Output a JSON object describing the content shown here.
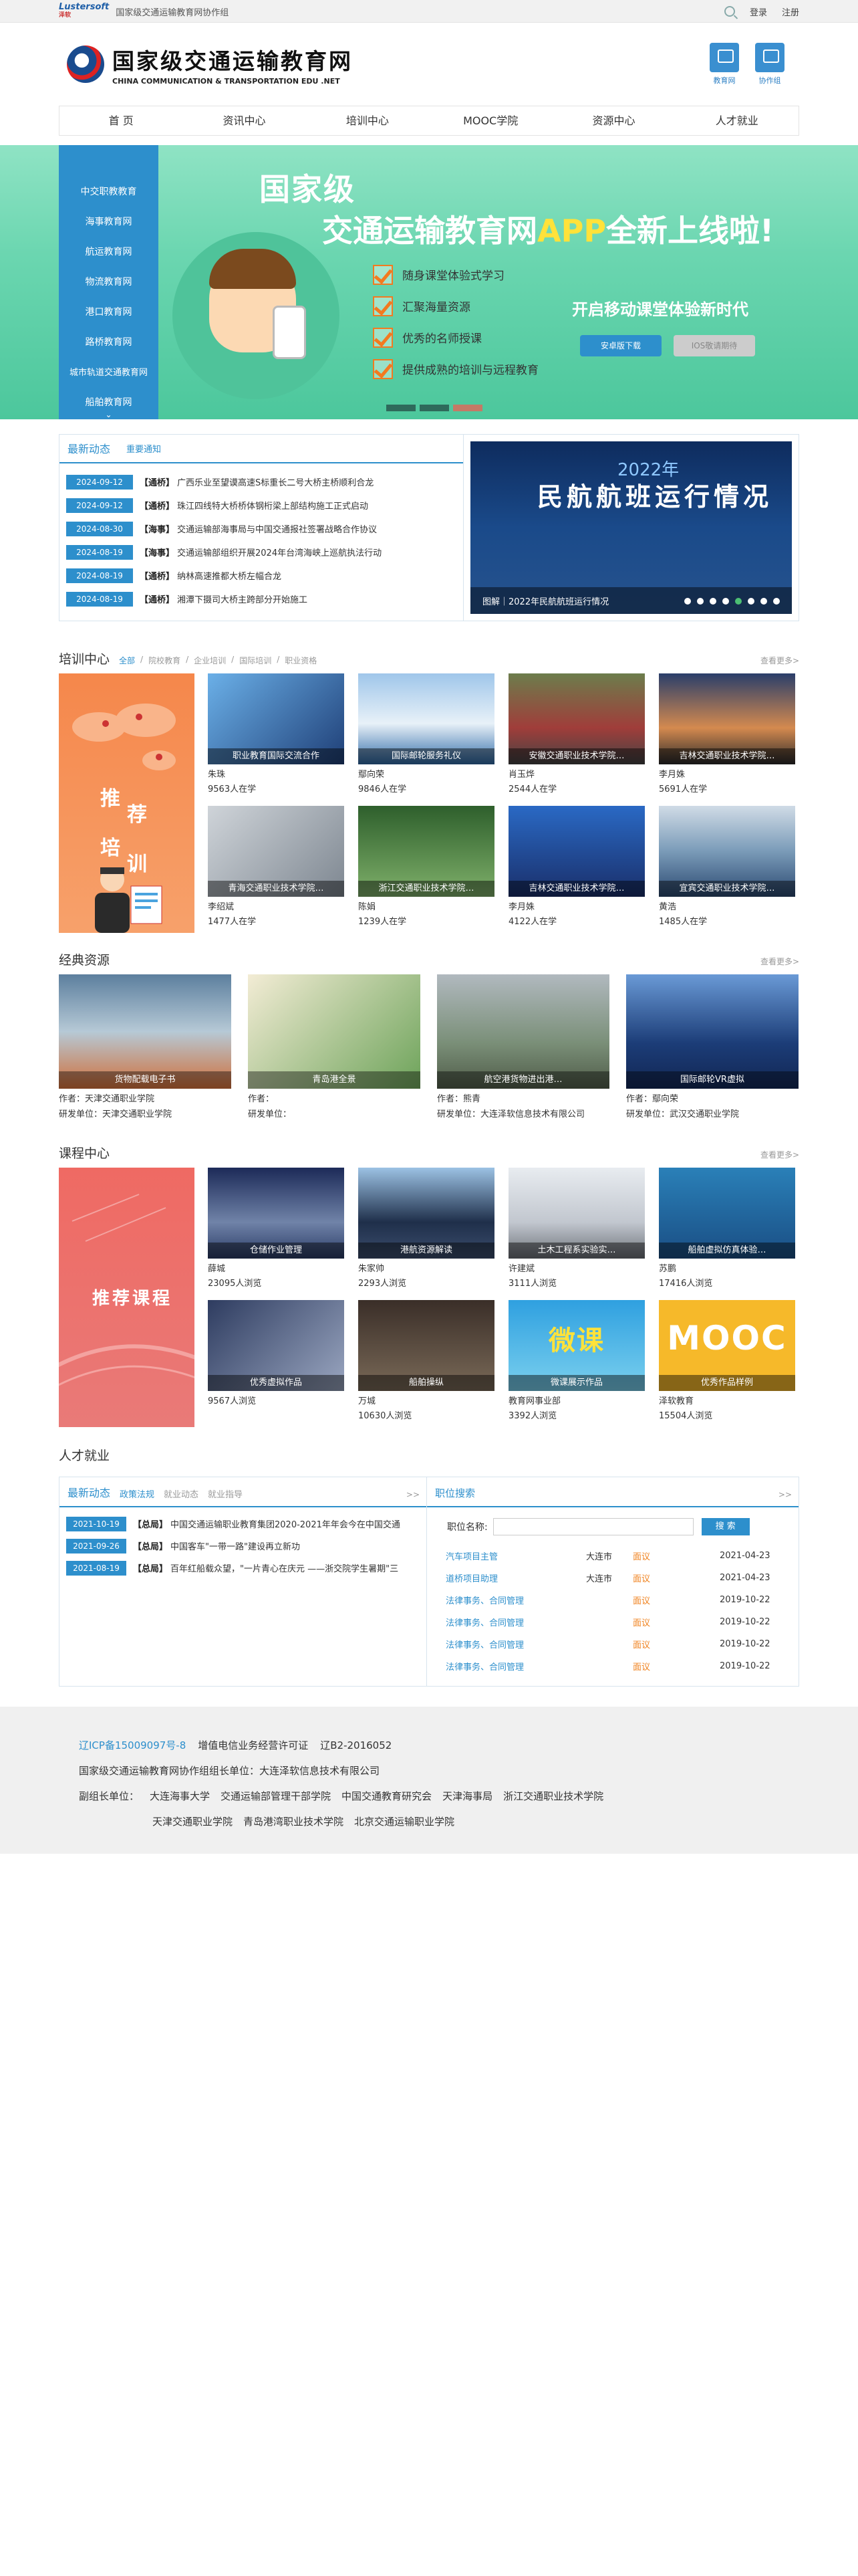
{
  "topbar": {
    "logo_en": "Lustersoft",
    "logo_cn": "泽软",
    "title": "国家级交通运输教育网协作组",
    "login": "登录",
    "register": "注册"
  },
  "header": {
    "logo_cn": "国家级交通运输教育网",
    "logo_en": "CHINA COMMUNICATION & TRANSPORTATION EDU .NET",
    "icon1": "教育网",
    "icon2": "协作组"
  },
  "nav": [
    "首 页",
    "资讯中心",
    "培训中心",
    "MOOC学院",
    "资源中心",
    "人才就业"
  ],
  "banner": {
    "menu": [
      "中交职教教育",
      "海事教育网",
      "航运教育网",
      "物流教育网",
      "港口教育网",
      "路桥教育网",
      "城市轨道交通教育网",
      "船舶教育网"
    ],
    "title1": "国家级",
    "title2a": "交通运输教育网",
    "title2b": "APP",
    "title2c": "全新上线啦!",
    "features": [
      "随身课堂体验式学习",
      "汇聚海量资源",
      "优秀的名师授课",
      "提供成熟的培训与远程教育"
    ],
    "slogan": "开启移动课堂体验新时代",
    "btn_android": "安卓版下载",
    "btn_ios": "IOS敬请期待"
  },
  "news": {
    "tab1": "最新动态",
    "tab2": "重要通知",
    "items": [
      {
        "date": "2024-09-12",
        "tag": "【通桥】",
        "text": "广西乐业至望谟高速S标重长二号大桥主桥顺利合龙"
      },
      {
        "date": "2024-09-12",
        "tag": "【通桥】",
        "text": "珠江四线特大桥桥体钢桁梁上部结构施工正式启动"
      },
      {
        "date": "2024-08-30",
        "tag": "【海事】",
        "text": "交通运输部海事局与中国交通报社签署战略合作协议"
      },
      {
        "date": "2024-08-19",
        "tag": "【海事】",
        "text": "交通运输部组织开展2024年台湾海峡上巡航执法行动"
      },
      {
        "date": "2024-08-19",
        "tag": "【通桥】",
        "text": "纳林高速推都大桥左幅合龙"
      },
      {
        "date": "2024-08-19",
        "tag": "【通桥】",
        "text": "湘潭下摄司大桥主跨部分开始施工"
      }
    ],
    "slide": {
      "year": "2022年",
      "title": "民航航班运行情况",
      "caption": "图解｜2022年民航航班运行情况"
    }
  },
  "training": {
    "title": "培训中心",
    "subtabs": [
      "全部",
      "/",
      "院校教育",
      "/",
      "企业培训",
      "/",
      "国际培训",
      "/",
      "职业资格"
    ],
    "more": "查看更多>",
    "promo": [
      "推",
      "荐",
      "培",
      "训"
    ],
    "cards": [
      {
        "overlay": "职业教育国际交流合作",
        "name": "朱珠",
        "count": "9563人在学"
      },
      {
        "overlay": "国际邮轮服务礼仪",
        "name": "鄢向荣",
        "count": "9846人在学"
      },
      {
        "overlay": "安徽交通职业技术学院…",
        "name": "肖玉烨",
        "count": "2544人在学"
      },
      {
        "overlay": "吉林交通职业技术学院…",
        "name": "李月姝",
        "count": "5691人在学"
      },
      {
        "overlay": "青海交通职业技术学院…",
        "name": "李绍斌",
        "count": "1477人在学"
      },
      {
        "overlay": "浙江交通职业技术学院…",
        "name": "陈娟",
        "count": "1239人在学"
      },
      {
        "overlay": "吉林交通职业技术学院…",
        "name": "李月姝",
        "count": "4122人在学"
      },
      {
        "overlay": "宜宾交通职业技术学院…",
        "name": "黄浩",
        "count": "1485人在学"
      }
    ]
  },
  "classic": {
    "title": "经典资源",
    "more": "查看更多>",
    "cards": [
      {
        "overlay": "货物配载电子书",
        "author": "作者：天津交通职业学院",
        "dev": "研发单位：天津交通职业学院"
      },
      {
        "overlay": "青岛港全景",
        "author": "作者：",
        "dev": "研发单位："
      },
      {
        "overlay": "航空港货物进出港…",
        "author": "作者：熊青",
        "dev": "研发单位：大连泽软信息技术有限公司"
      },
      {
        "overlay": "国际邮轮VR虚拟",
        "author": "作者：鄢向荣",
        "dev": "研发单位：武汉交通职业学院"
      }
    ]
  },
  "courses": {
    "title": "课程中心",
    "more": "查看更多>",
    "promo": "推荐课程",
    "cards": [
      {
        "overlay": "仓储作业管理",
        "name": "薛城",
        "count": "23095人浏览"
      },
      {
        "overlay": "港航资源解读",
        "name": "朱家帅",
        "count": "2293人浏览"
      },
      {
        "overlay": "土木工程系实验实…",
        "name": "许建斌",
        "count": "3111人浏览"
      },
      {
        "overlay": "船舶虚拟仿真体验…",
        "name": "苏鹏",
        "count": "17416人浏览"
      },
      {
        "overlay": "优秀虚拟作品",
        "name": "",
        "count": "9567人浏览"
      },
      {
        "overlay": "船舶操纵",
        "name": "万城",
        "count": "10630人浏览"
      },
      {
        "overlay": "微课展示作品",
        "name": "教育网事业部",
        "count": "3392人浏览",
        "badge": "微课"
      },
      {
        "overlay": "优秀作品样例",
        "name": "泽软教育",
        "count": "15504人浏览",
        "badge": "MOOC"
      }
    ]
  },
  "talent": {
    "title": "人才就业",
    "tab_main": "最新动态",
    "subtabs": [
      "政策法规",
      "就业动态",
      "就业指导"
    ],
    "arrows": ">>",
    "items": [
      {
        "date": "2021-10-19",
        "tag": "【总局】",
        "text": "中国交通运输职业教育集团2020-2021年年会今在中国交通"
      },
      {
        "date": "2021-09-26",
        "tag": "【总局】",
        "text": "中国客车\"一带一路\"建设再立新功"
      },
      {
        "date": "2021-08-19",
        "tag": "【总局】",
        "text": "百年红船载众望，\"一片青心在庆元 ——浙交院学生暑期\"三"
      }
    ],
    "jobs_title": "职位搜索",
    "search_label": "职位名称:",
    "search_btn": "搜 索",
    "jobs": [
      {
        "title": "汽车项目主管",
        "city": "大连市",
        "pay": "面议",
        "date": "2021-04-23"
      },
      {
        "title": "道桥项目助理",
        "city": "大连市",
        "pay": "面议",
        "date": "2021-04-23"
      },
      {
        "title": "法律事务、合同管理",
        "city": "",
        "pay": "面议",
        "date": "2019-10-22"
      },
      {
        "title": "法律事务、合同管理",
        "city": "",
        "pay": "面议",
        "date": "2019-10-22"
      },
      {
        "title": "法律事务、合同管理",
        "city": "",
        "pay": "面议",
        "date": "2019-10-22"
      },
      {
        "title": "法律事务、合同管理",
        "city": "",
        "pay": "面议",
        "date": "2019-10-22"
      }
    ]
  },
  "footer": {
    "icp": "辽ICP备15009097号-8",
    "license": "增值电信业务经营许可证",
    "license_no": "辽B2-2016052",
    "leader": "国家级交通运输教育网协作组组长单位：大连泽软信息技术有限公司",
    "vice_label": "副组长单位：",
    "vice1": [
      "大连海事大学",
      "交通运输部管理干部学院",
      "中国交通教育研究会",
      "天津海事局",
      "浙江交通职业技术学院"
    ],
    "vice2": [
      "天津交通职业学院",
      "青岛港湾职业技术学院",
      "北京交通运输职业学院"
    ]
  }
}
